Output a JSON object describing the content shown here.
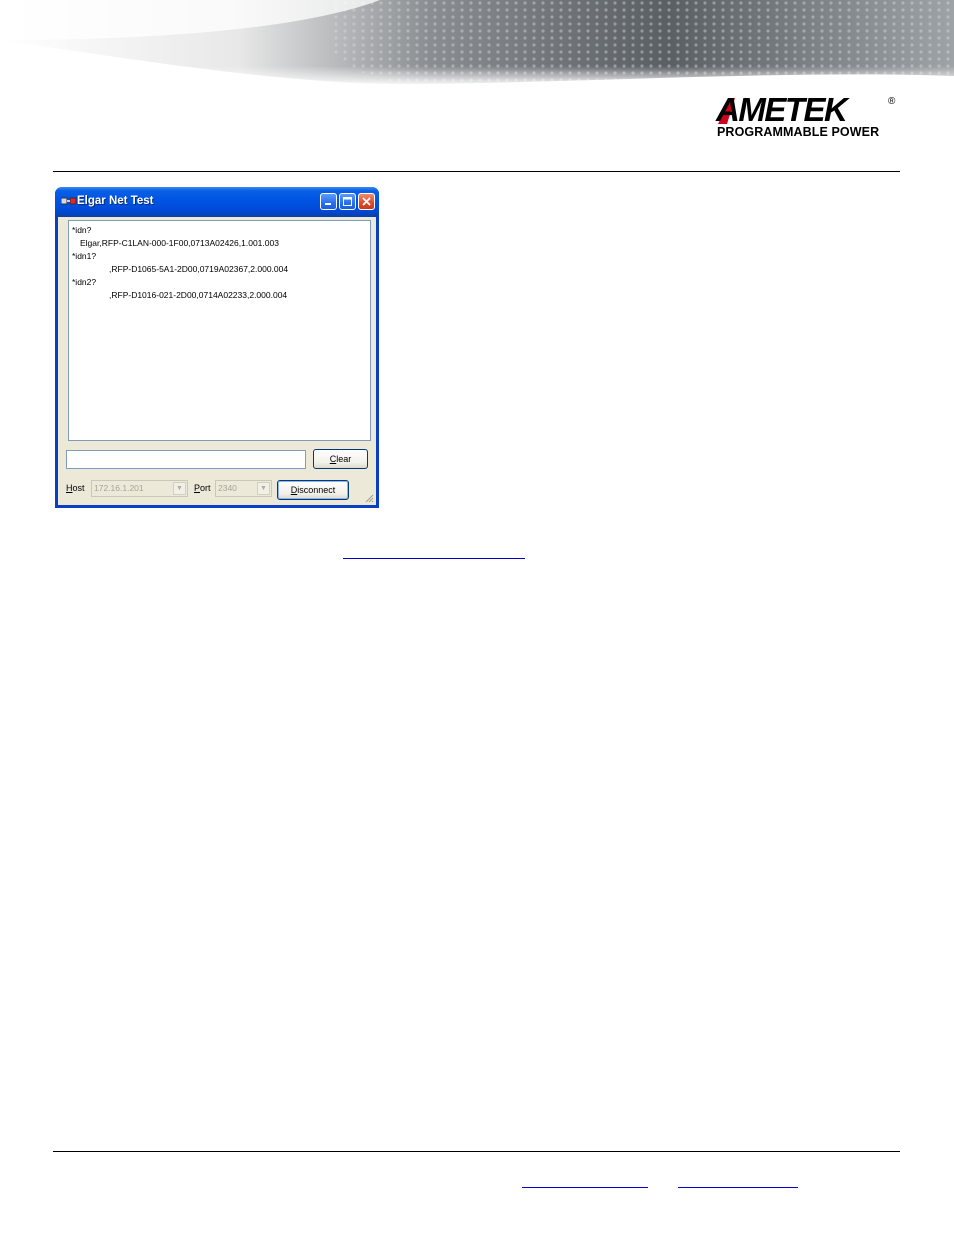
{
  "brand": {
    "logo_word": "AMETEK",
    "logo_reg": "®",
    "logo_sub": "PROGRAMMABLE POWER",
    "accent_color": "#d0021b"
  },
  "window": {
    "title": "Elgar Net Test",
    "icon": "network-app-icon",
    "output_lines": [
      "*idn?",
      "Elgar,RFP-C1LAN-000-1F00,0713A02426,1.001.003",
      "*idn1?",
      ",RFP-D1065-5A1-2D00,0719A02367,2.000.004",
      "*idn2?",
      ",RFP-D1016-021-2D00,0714A02233,2.000.004"
    ],
    "command_input_value": "",
    "clear_button": {
      "prefix": "",
      "accel": "C",
      "rest": "lear"
    },
    "host": {
      "accel": "H",
      "rest": "ost",
      "value": "172.16.1.201"
    },
    "port": {
      "accel": "P",
      "rest": "ort",
      "value": "2340"
    },
    "disconnect_button": {
      "accel": "D",
      "rest": "isconnect"
    }
  }
}
